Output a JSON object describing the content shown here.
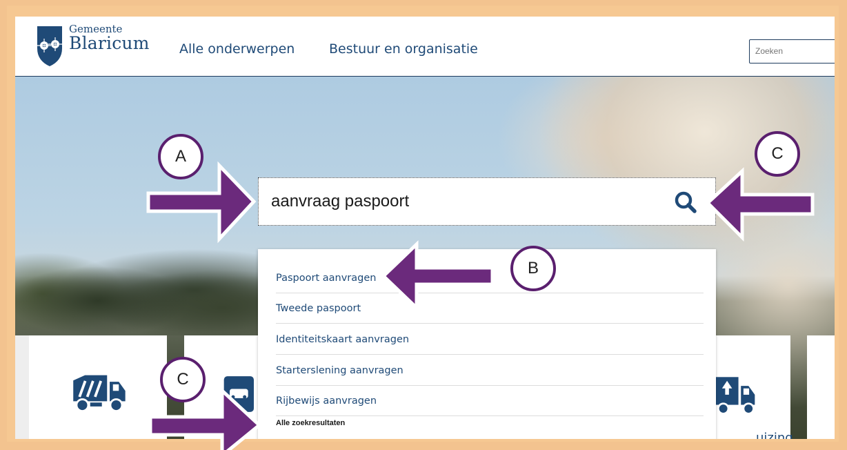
{
  "brand": {
    "line1": "Gemeente",
    "line2": "Blaricum"
  },
  "nav": {
    "item1": "Alle onderwerpen",
    "item2": "Bestuur en organisatie"
  },
  "top_search": {
    "placeholder": "Zoeken"
  },
  "main_search": {
    "value": "aanvraag paspoort"
  },
  "suggestions": [
    {
      "label": "Paspoort aanvragen"
    },
    {
      "label": "Tweede paspoort"
    },
    {
      "label": "Identiteitskaart aanvragen"
    },
    {
      "label": "Starterslening aanvragen"
    },
    {
      "label": "Rijbewijs aanvragen"
    }
  ],
  "all_results_label": "Alle zoekresultaten",
  "tile_label_partial": "uizing",
  "markers": {
    "a": "A",
    "b": "B",
    "c_top": "C",
    "c_bottom": "C"
  },
  "colors": {
    "brand_blue": "#1f4a77",
    "annotation_purple": "#6b2a7c",
    "frame_orange": "#f6c892"
  },
  "icons": [
    "gemeente-crest-icon",
    "search-icon",
    "garbage-truck-icon",
    "car-icon",
    "moving-truck-icon"
  ]
}
